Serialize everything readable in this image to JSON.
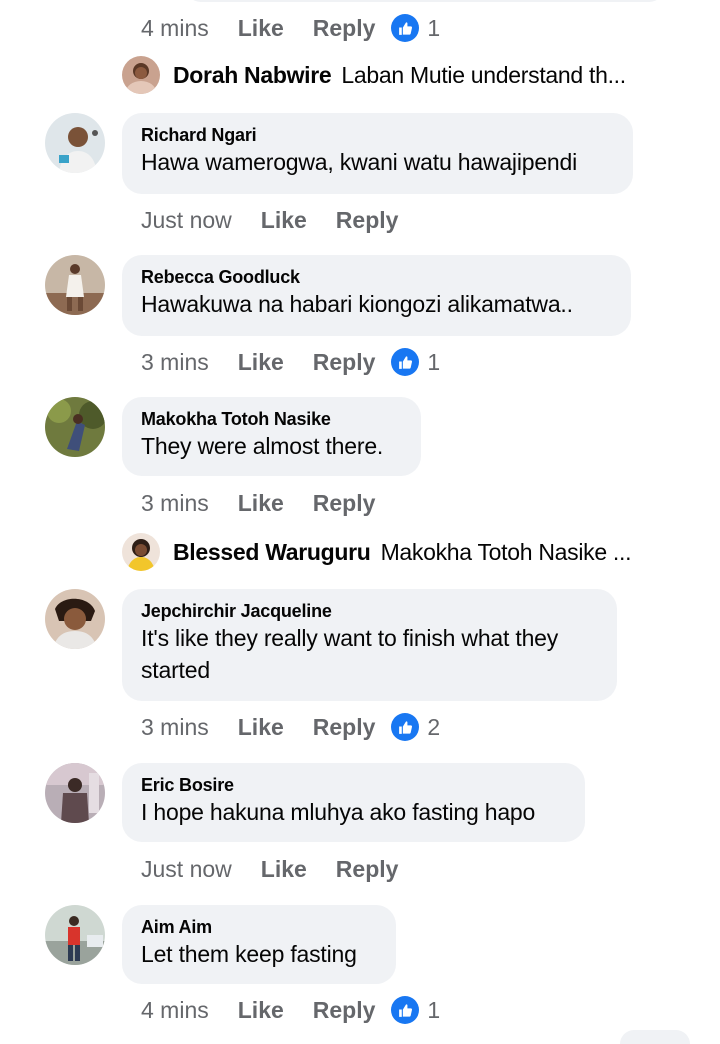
{
  "top_actions": {
    "time": "4 mins",
    "like": "Like",
    "reply": "Reply",
    "reactions": "1"
  },
  "replies": [
    {
      "name": "Dorah Nabwire",
      "text": "Laban Mutie understand th..."
    },
    {
      "name": "Blessed Waruguru",
      "text": "Makokha Totoh Nasike  ..."
    }
  ],
  "comments": [
    {
      "author": "Richard Ngari",
      "text": "Hawa wamerogwa, kwani watu hawajipendi",
      "time": "Just now",
      "like": "Like",
      "reply": "Reply",
      "reactions": ""
    },
    {
      "author": "Rebecca Goodluck",
      "text": "Hawakuwa na habari kiongozi alikamatwa..",
      "time": "3 mins",
      "like": "Like",
      "reply": "Reply",
      "reactions": "1"
    },
    {
      "author": "Makokha Totoh Nasike",
      "text": "They were almost there.",
      "time": "3 mins",
      "like": "Like",
      "reply": "Reply",
      "reactions": ""
    },
    {
      "author": "Jepchirchir Jacqueline",
      "text": "It's like they really want to finish what they started",
      "time": "3 mins",
      "like": "Like",
      "reply": "Reply",
      "reactions": "2"
    },
    {
      "author": "Eric Bosire",
      "text": "I hope hakuna mluhya ako fasting hapo",
      "time": "Just now",
      "like": "Like",
      "reply": "Reply",
      "reactions": ""
    },
    {
      "author": "Aim Aim",
      "text": "Let them keep fasting",
      "time": "4 mins",
      "like": "Like",
      "reply": "Reply",
      "reactions": "1"
    }
  ],
  "colors": {
    "bubble": "#f0f2f5",
    "meta": "#65676b",
    "like_blue": "#1877f2",
    "text": "#050505"
  },
  "icons": {
    "reaction": "thumbs-up-icon"
  }
}
